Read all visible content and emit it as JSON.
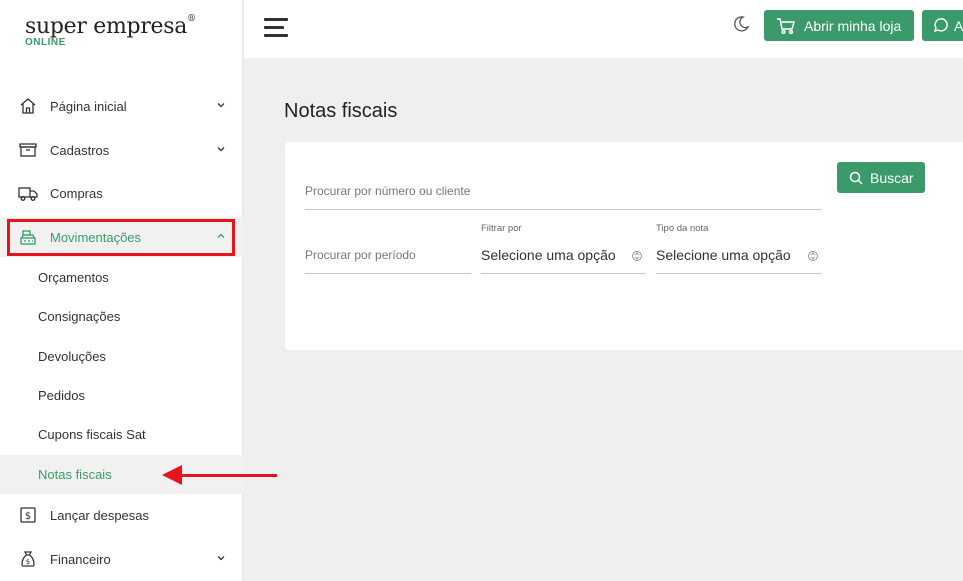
{
  "brand": {
    "name": "super empresa",
    "registered": "®",
    "tagline": "ONLINE",
    "accent": "#3a9a6a"
  },
  "sidebar": {
    "items": [
      {
        "label": "Página inicial",
        "icon": "home-icon",
        "expandable": true
      },
      {
        "label": "Cadastros",
        "icon": "box-icon",
        "expandable": true
      },
      {
        "label": "Compras",
        "icon": "truck-icon",
        "expandable": false
      },
      {
        "label": "Movimentações",
        "icon": "cash-register-icon",
        "expandable": true,
        "expanded": true
      },
      {
        "label": "Lançar despesas",
        "icon": "dollar-bill-icon",
        "expandable": false
      },
      {
        "label": "Financeiro",
        "icon": "money-bag-icon",
        "expandable": true
      }
    ],
    "subitems": [
      {
        "label": "Orçamentos"
      },
      {
        "label": "Consignações"
      },
      {
        "label": "Devoluções"
      },
      {
        "label": "Pedidos"
      },
      {
        "label": "Cupons fiscais Sat"
      },
      {
        "label": "Notas fiscais",
        "current": true
      }
    ]
  },
  "topbar": {
    "store_button": "Abrir minha loja",
    "whatsapp_button": "A"
  },
  "main": {
    "title": "Notas fiscais",
    "search_placeholder": "Procurar por número ou cliente",
    "search_button": "Buscar",
    "period_placeholder": "Procurar por período",
    "filter": {
      "label": "Filtrar por",
      "value": "Selecione uma opção"
    },
    "note_type": {
      "label": "Tipo da nota",
      "value": "Selecione uma opção"
    }
  },
  "colors": {
    "accent": "#3a9a6a",
    "annotation": "#e8141b",
    "background": "#efefef"
  }
}
